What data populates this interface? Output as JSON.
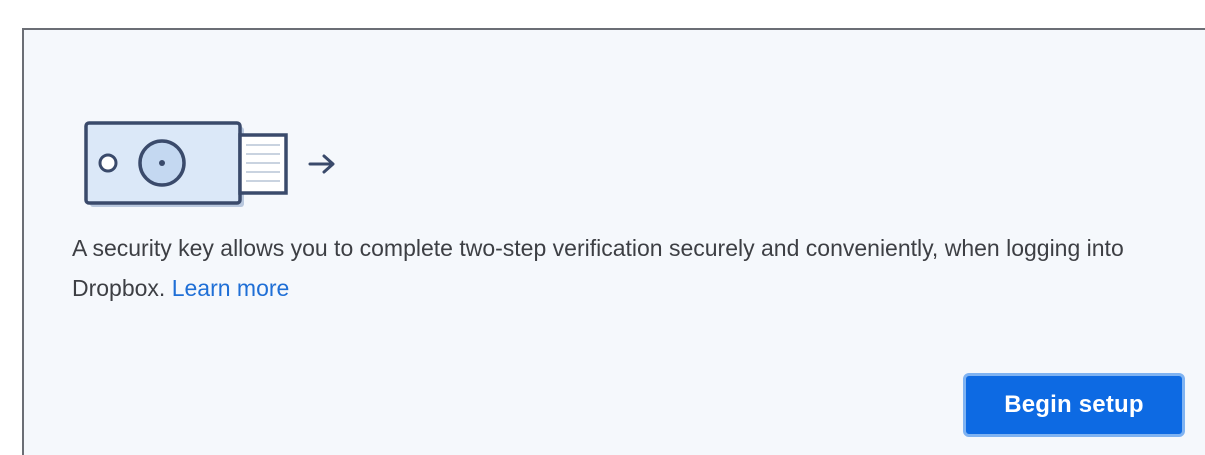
{
  "illustration": {
    "name": "security-key-illustration",
    "icon": "security-key-icon",
    "arrow_icon": "arrow-right-icon"
  },
  "description": {
    "text": "A security key allows you to complete two-step verification securely and conveniently, when logging into Dropbox. ",
    "link_label": "Learn more"
  },
  "actions": {
    "begin_setup_label": "Begin setup"
  },
  "colors": {
    "accent": "#0d6ae3",
    "link": "#1f6fd6",
    "panel_background": "#f5f8fc",
    "text": "#3d3f44",
    "illustration_stroke": "#3a4a6b",
    "illustration_fill": "#dbe8f8"
  }
}
